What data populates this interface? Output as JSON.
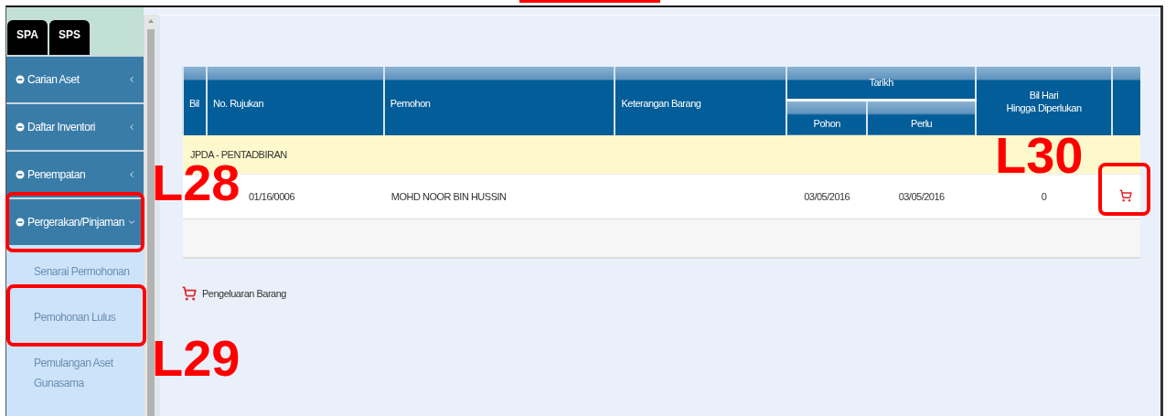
{
  "tabs": [
    {
      "label": "SPA"
    },
    {
      "label": "SPS"
    }
  ],
  "menu": [
    {
      "label": "Carian Aset",
      "expanded": false
    },
    {
      "label": "Daftar Inventori",
      "expanded": false
    },
    {
      "label": "Penempatan",
      "expanded": false
    },
    {
      "label": "Pergerakan/Pinjaman",
      "expanded": true,
      "children": [
        {
          "label": "Senarai Permohonan"
        },
        {
          "label": "Pemohonan Lulus"
        },
        {
          "label": "Pemulangan Aset Gunasama"
        }
      ]
    }
  ],
  "table": {
    "columns": [
      "Bil",
      "No. Rujukan",
      "Pemohon",
      "Keterangan Barang"
    ],
    "date_group": "Tarikh",
    "date_columns": [
      "Pohon",
      "Perlu"
    ],
    "days_column": [
      "Bil Hari",
      "Hingga Diperlukan"
    ],
    "groups": [
      {
        "title": "JPDA - PENTADBIRAN",
        "rows": [
          {
            "no_rujukan": "01/16/0006",
            "pemohon": "MOHD NOOR BIN HUSSIN",
            "pohon": "03/05/2016",
            "perlu": "03/05/2016",
            "bil_hari": "0"
          }
        ]
      }
    ]
  },
  "footer_link": "Pengeluaran Barang",
  "annotations": [
    {
      "label": "L28"
    },
    {
      "label": "L29"
    },
    {
      "label": "L30"
    }
  ]
}
